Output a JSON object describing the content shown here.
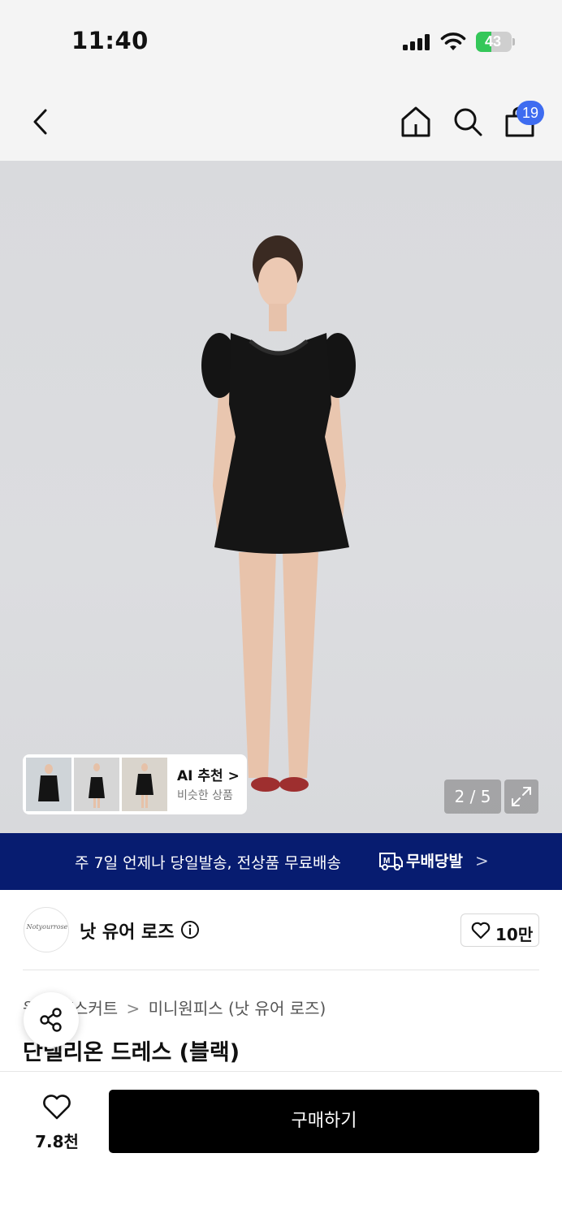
{
  "status_bar": {
    "time": "11:40",
    "battery": "43",
    "battery_level": 0.43
  },
  "nav": {
    "cart_count": "19"
  },
  "gallery": {
    "page_indicator": "2 / 5",
    "ai_card": {
      "title": "AI 추천 >",
      "subtitle": "비슷한 상품"
    }
  },
  "delivery_banner": {
    "text": "주 7일 언제나 당일발송, 전상품 무료배송",
    "brand": "무배당발",
    "chevron": ">"
  },
  "brand": {
    "name": "낫 유어 로즈",
    "logo_text": "Notyourrose",
    "like_count": "10만"
  },
  "breadcrumb": {
    "items": [
      "원피스/스커트",
      "미니원피스 (낫 유어 로즈)"
    ],
    "separator": ">"
  },
  "product": {
    "title": "단델리온 드레스 (블랙)"
  },
  "bottom_bar": {
    "wish_count": "7.8천",
    "buy_label": "구매하기"
  },
  "colors": {
    "accent_blue": "#3e6cf0",
    "banner_navy": "#071c70",
    "buy_black": "#000000",
    "battery_green": "#34c759"
  }
}
